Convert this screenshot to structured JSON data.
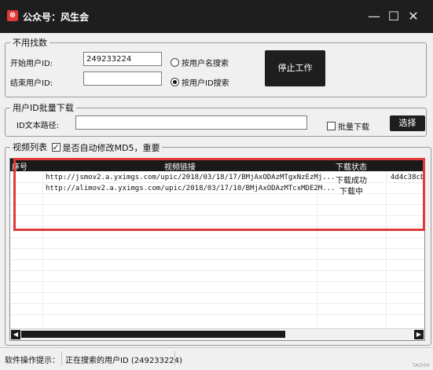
{
  "window": {
    "title": "公众号：风生会",
    "app_icon_glyph": "⊗",
    "minimize": "—",
    "maximize": "☐",
    "close": "✕",
    "titlebar_color": "#1e1e1e"
  },
  "paging": {
    "legend": "不用找数",
    "start_id_label": "开始用户ID:",
    "start_id_value": "249233224",
    "end_id_label": "结束用户ID:",
    "end_id_value": "",
    "radio_by_name": "按用户名搜索",
    "radio_by_id": "按用户ID搜索",
    "selected_mode": "by_id",
    "stop_button": "停止工作"
  },
  "batch": {
    "legend": "用户ID批量下载",
    "path_label": "ID文本路径:",
    "path_value": "",
    "batch_checkbox": "批量下载",
    "batch_checked": false,
    "choose_button": "选择"
  },
  "list": {
    "legend": "视频列表",
    "auto_modify_checkbox": "是否自动修改MD5，重要",
    "auto_modify_checked": true,
    "columns": [
      "序号",
      "视频链接",
      "下载状态",
      ""
    ],
    "rows": [
      {
        "index": "",
        "url": "http://jsmov2.a.yximgs.com/upic/2018/03/18/17/BMjAxODAzMTgxNzEzMj...",
        "status": "下载成功",
        "md5": "4d4c38cb"
      },
      {
        "index": "",
        "url": "http://alimov2.a.yximgs.com/upic/2018/03/17/10/BMjAxODAzMTcxMDE2M...",
        "status": "下载中",
        "md5": ""
      }
    ],
    "scroll_left": "◀",
    "scroll_right": "▶",
    "highlight_color": "#e03a3a"
  },
  "statusbar": {
    "hint_label": "软件操作提示：",
    "message": "正在搜索的用户ID (249233224)",
    "watermark": "TAOHIX"
  }
}
